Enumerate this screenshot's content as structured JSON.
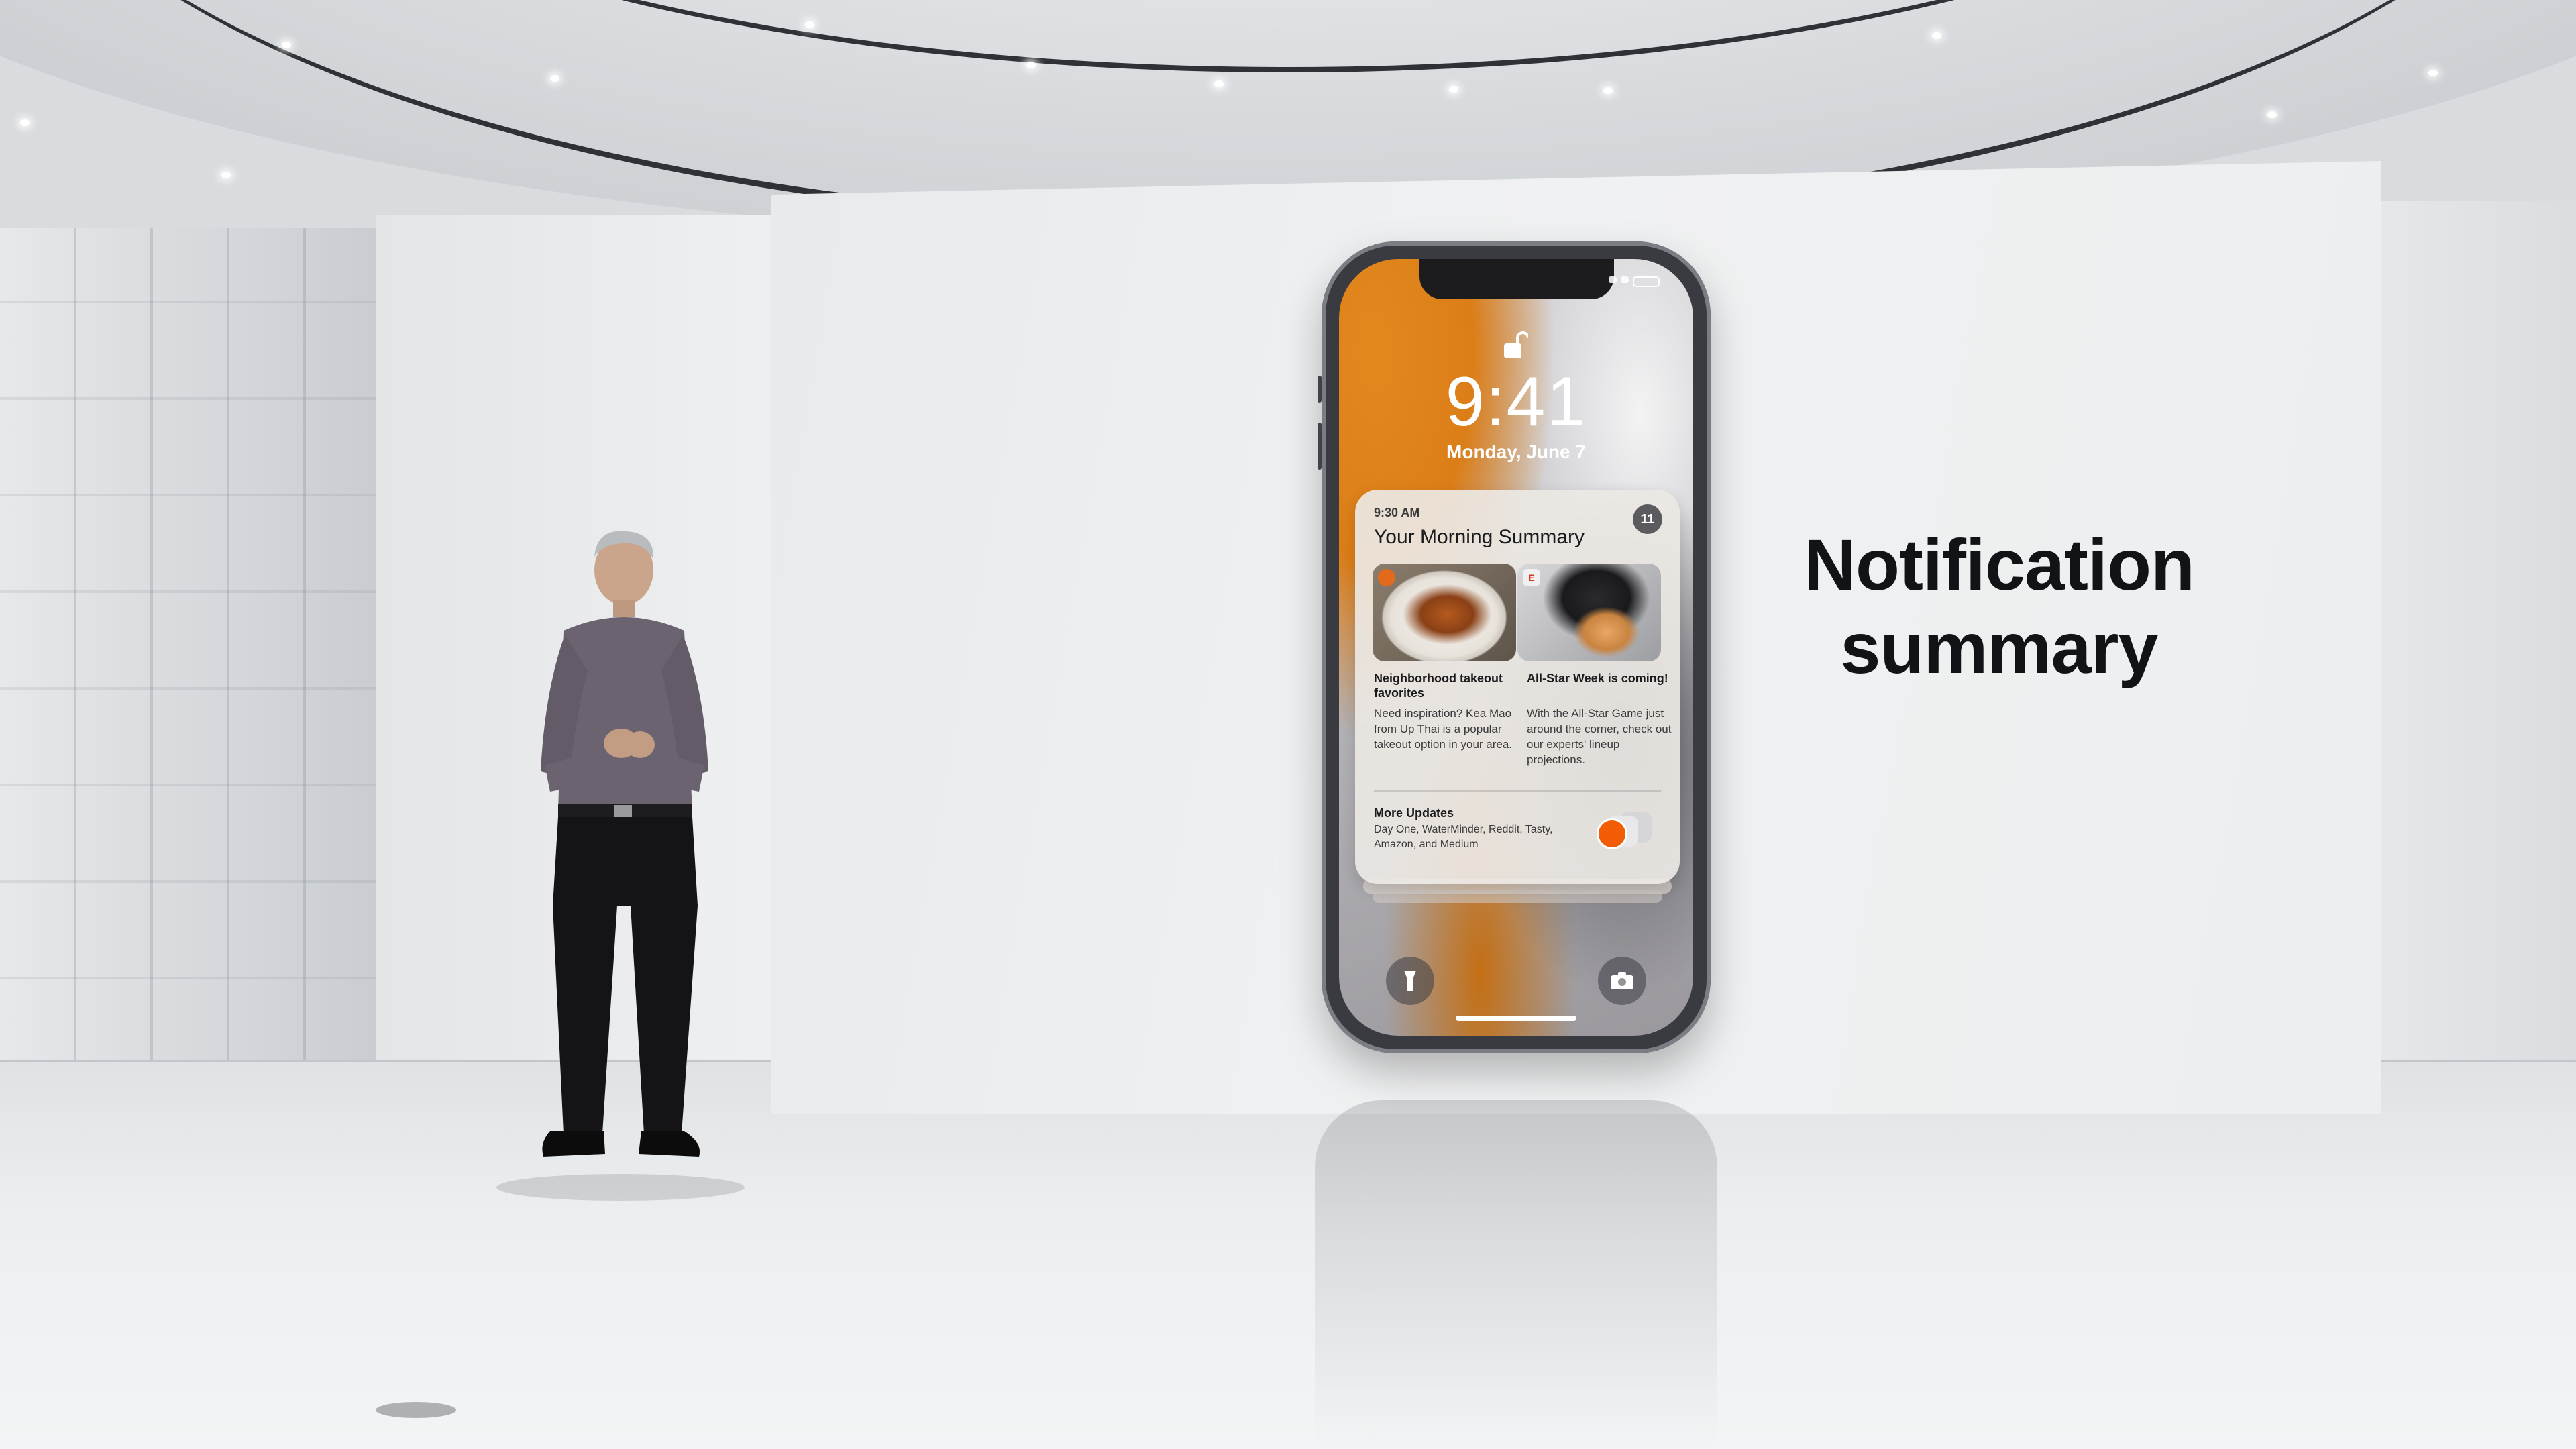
{
  "slide": {
    "title_line1": "Notification",
    "title_line2": "summary"
  },
  "phone": {
    "lock_time": "9:41",
    "lock_date": "Monday, June 7",
    "notification": {
      "time": "9:30 AM",
      "title": "Your Morning Summary",
      "badge_count": "11",
      "stories": [
        {
          "headline": "Neighborhood takeout favorites",
          "body": "Need inspiration? Kea Mao from Up Thai is a popular takeout option in your area."
        },
        {
          "headline": "All-Star Week is coming!",
          "body": "With the All-Star Game just around the corner, check out our experts' lineup projections."
        }
      ],
      "more_updates": {
        "heading": "More Updates",
        "body": "Day One, WaterMinder, Reddit, Tasty, Amazon, and Medium"
      }
    },
    "icons": {
      "lock": "lock-open-icon",
      "flashlight": "flashlight-icon",
      "camera": "camera-icon"
    }
  },
  "colors": {
    "wallpaper_orange": "#dc7e18",
    "title_text": "#111316",
    "badge": "#5b5b5f"
  }
}
